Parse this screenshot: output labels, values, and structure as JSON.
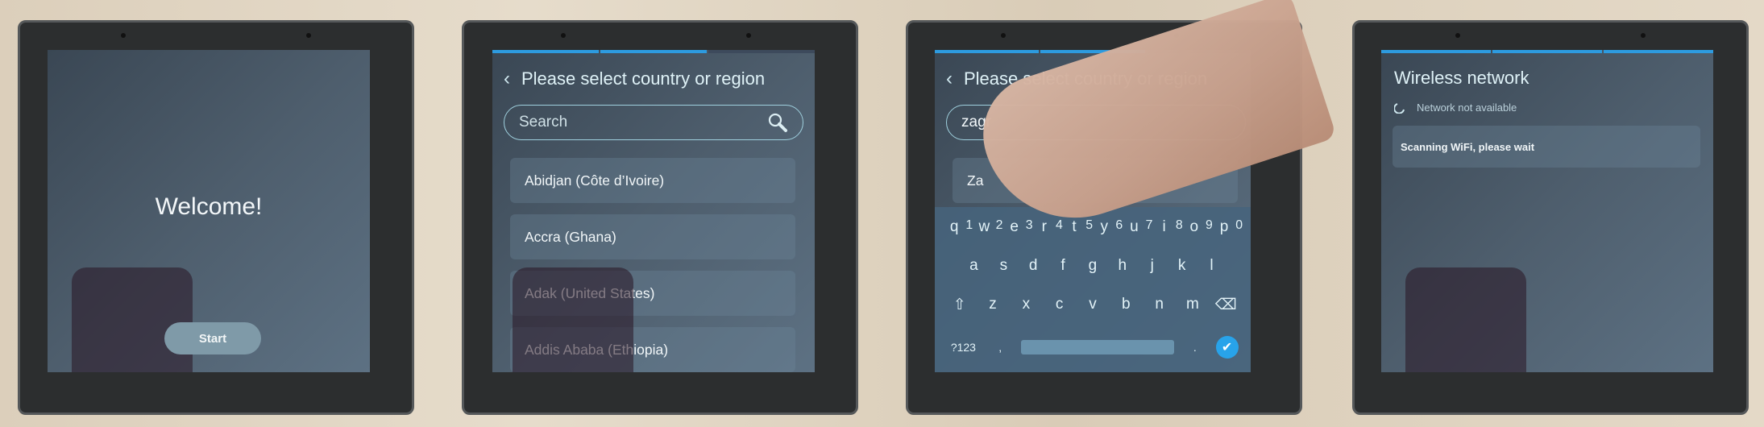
{
  "panels": {
    "welcome": {
      "title": "Welcome!",
      "start_label": "Start"
    },
    "country_select": {
      "progress_steps": [
        true,
        true,
        false
      ],
      "title": "Please select country or region",
      "search_placeholder": "Search",
      "items": [
        "Abidjan (Côte d’Ivoire)",
        "Accra (Ghana)",
        "Adak (United States)",
        "Addis Ababa (Ethiopia)"
      ]
    },
    "country_search_keyboard": {
      "progress_steps": [
        true,
        true,
        false
      ],
      "title": "Please select country or region",
      "search_value": "zagr",
      "result_partial": "Za",
      "keyboard": {
        "row1": [
          [
            "q",
            "1"
          ],
          [
            "w",
            "2"
          ],
          [
            "e",
            "3"
          ],
          [
            "r",
            "4"
          ],
          [
            "t",
            "5"
          ],
          [
            "y",
            "6"
          ],
          [
            "u",
            "7"
          ],
          [
            "i",
            "8"
          ],
          [
            "o",
            "9"
          ],
          [
            "p",
            "0"
          ]
        ],
        "row2": [
          "a",
          "s",
          "d",
          "f",
          "g",
          "h",
          "j",
          "k",
          "l"
        ],
        "row3": [
          "z",
          "x",
          "c",
          "v",
          "b",
          "n",
          "m"
        ],
        "symbols_label": "?123",
        "comma": ",",
        "period": "."
      }
    },
    "wireless": {
      "progress_steps": [
        true,
        true,
        true
      ],
      "title": "Wireless network",
      "status": "Network not available",
      "scan_message": "Scanning WiFi, please wait"
    }
  },
  "colors": {
    "accent": "#2d9be0",
    "confirm": "#28a3ea"
  }
}
